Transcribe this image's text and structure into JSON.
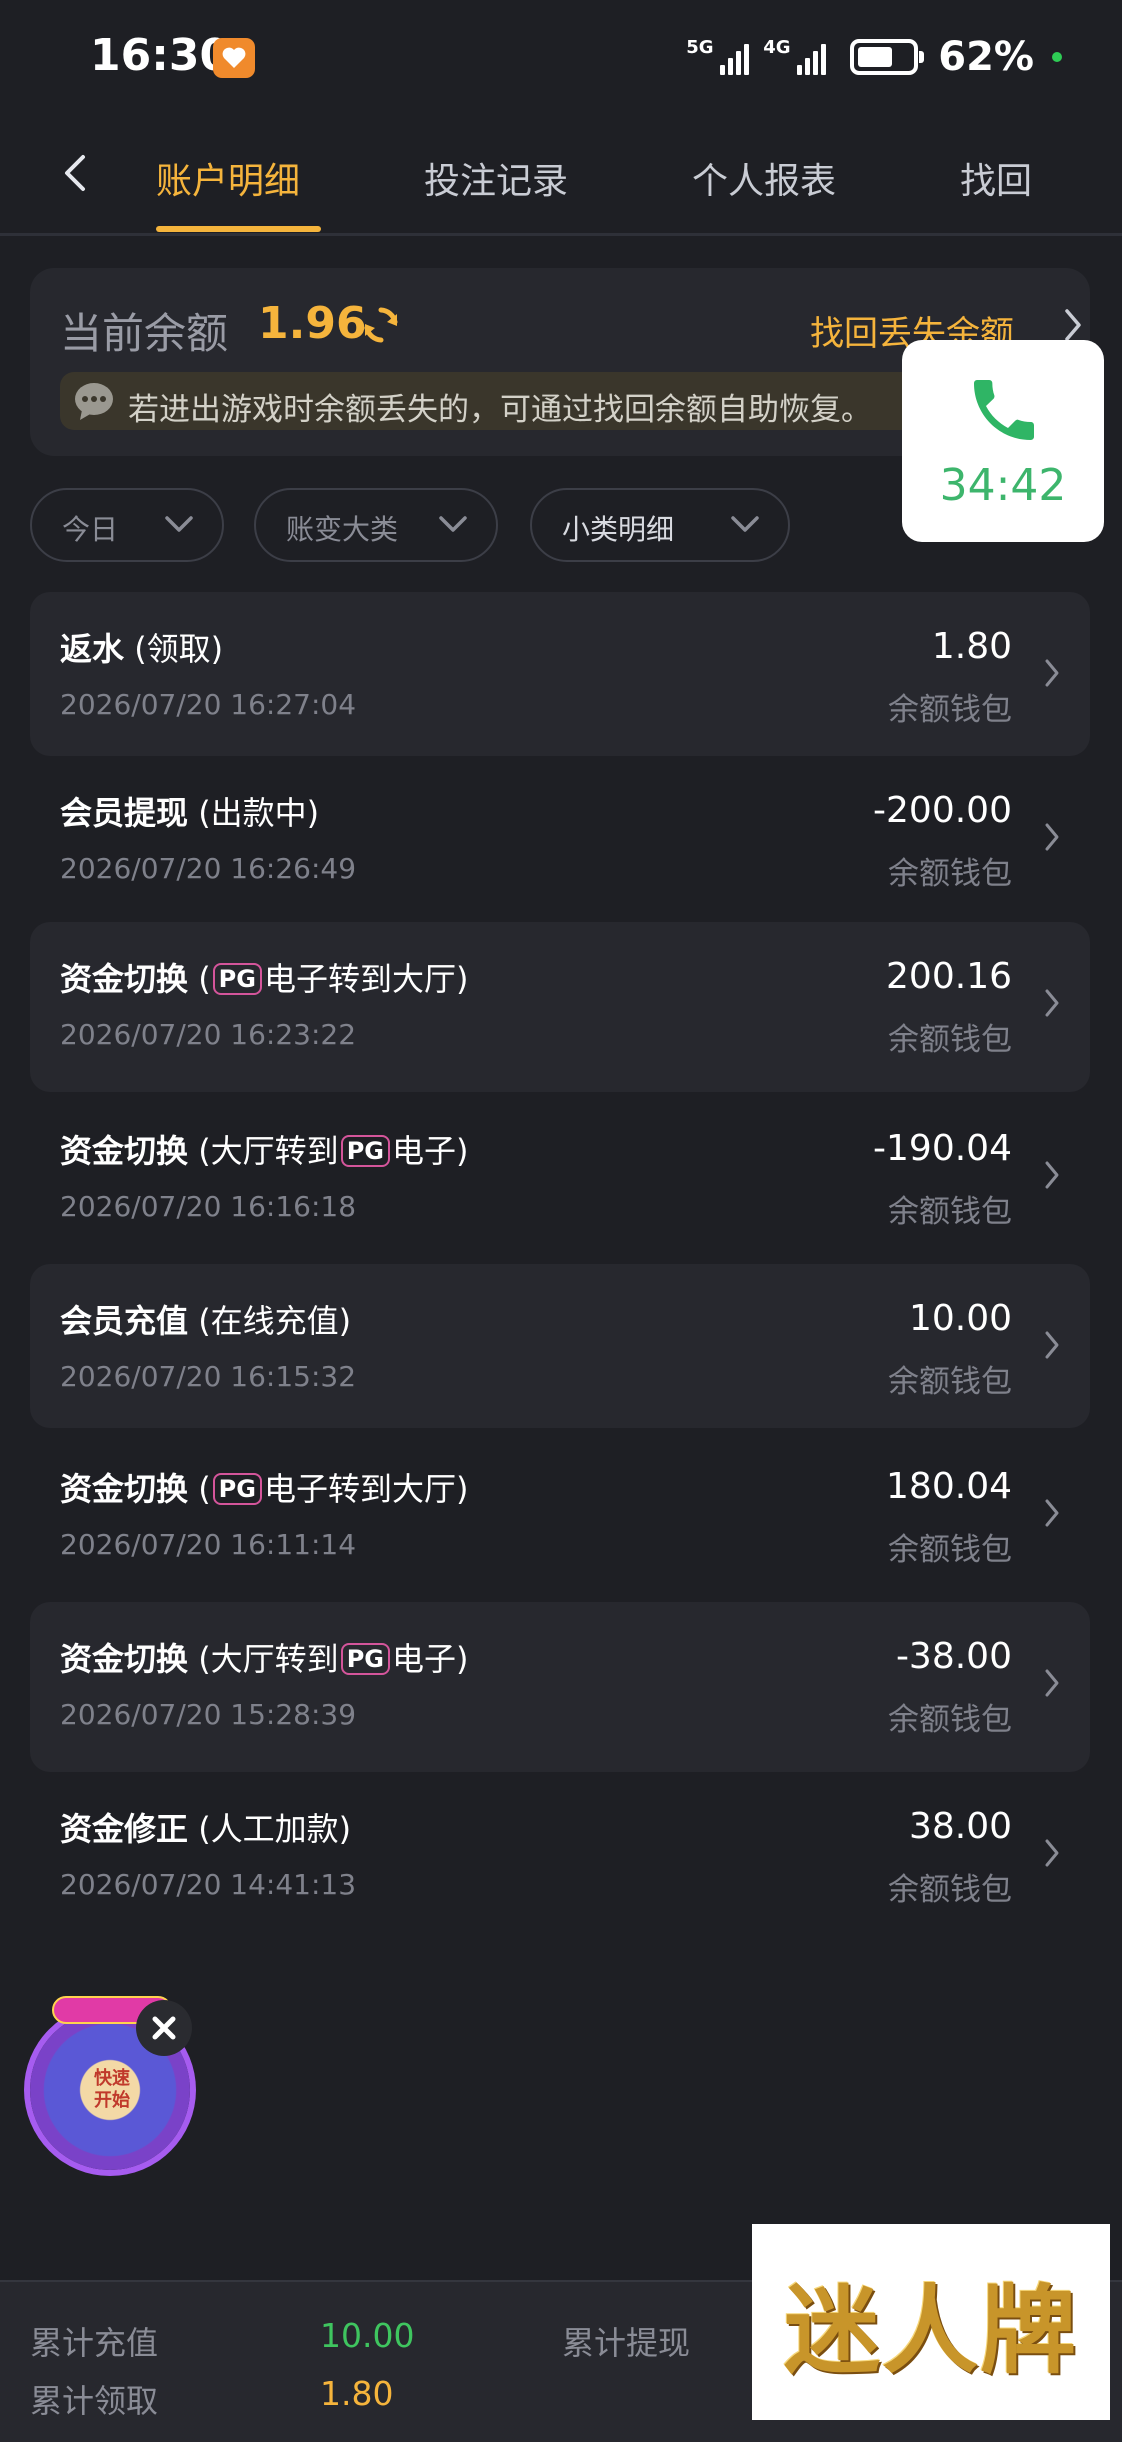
{
  "status_bar": {
    "time": "16:30",
    "net1": "5G",
    "net2": "4G",
    "battery": "62%"
  },
  "tabs": [
    {
      "label": "账户明细",
      "active": true
    },
    {
      "label": "投注记录",
      "active": false
    },
    {
      "label": "个人报表",
      "active": false
    },
    {
      "label": "找回",
      "active": false
    }
  ],
  "balance": {
    "label": "当前余额",
    "value": "1.96",
    "recover_label": "找回丢失余额",
    "notice": "若进出游戏时余额丢失的，可通过找回余额自助恢复。"
  },
  "call_popup": {
    "duration": "34:42"
  },
  "filters": [
    {
      "label": "今日"
    },
    {
      "label": "账变大类"
    },
    {
      "label": "小类明细"
    }
  ],
  "transactions": [
    {
      "type": "返水",
      "detail_pre": " (领取)",
      "pg": "",
      "detail_post": "",
      "time": "2026/07/20 16:27:04",
      "amount": "1.80",
      "wallet": "余额钱包"
    },
    {
      "type": "会员提现",
      "detail_pre": " (出款中)",
      "pg": "",
      "detail_post": "",
      "time": "2026/07/20 16:26:49",
      "amount": "-200.00",
      "wallet": "余额钱包"
    },
    {
      "type": "资金切换",
      "detail_pre": " (",
      "pg": "PG",
      "detail_post": "电子转到大厅)",
      "time": "2026/07/20 16:23:22",
      "amount": "200.16",
      "wallet": "余额钱包"
    },
    {
      "type": "资金切换",
      "detail_pre": " (大厅转到",
      "pg": "PG",
      "detail_post": "电子)",
      "time": "2026/07/20 16:16:18",
      "amount": "-190.04",
      "wallet": "余额钱包"
    },
    {
      "type": "会员充值",
      "detail_pre": " (在线充值)",
      "pg": "",
      "detail_post": "",
      "time": "2026/07/20 16:15:32",
      "amount": "10.00",
      "wallet": "余额钱包"
    },
    {
      "type": "资金切换",
      "detail_pre": " (",
      "pg": "PG",
      "detail_post": "电子转到大厅)",
      "time": "2026/07/20 16:11:14",
      "amount": "180.04",
      "wallet": "余额钱包"
    },
    {
      "type": "资金切换",
      "detail_pre": " (大厅转到",
      "pg": "PG",
      "detail_post": "电子)",
      "time": "2026/07/20 15:28:39",
      "amount": "-38.00",
      "wallet": "余额钱包"
    },
    {
      "type": "资金修正",
      "detail_pre": " (人工加款)",
      "pg": "",
      "detail_post": "",
      "time": "2026/07/20 14:41:13",
      "amount": "38.00",
      "wallet": "余额钱包"
    }
  ],
  "game_widget": {
    "label": "快速开始"
  },
  "footer": {
    "total_deposit_label": "累计充值",
    "total_deposit": "10.00",
    "total_withdraw_label": "累计提现",
    "total_claim_label": "累计领取",
    "total_claim": "1.80"
  },
  "watermark": "迷人牌",
  "colors": {
    "accent": "#f5b43c",
    "positive": "#3fc55f",
    "background": "#1e1f24",
    "card": "#27282e"
  }
}
